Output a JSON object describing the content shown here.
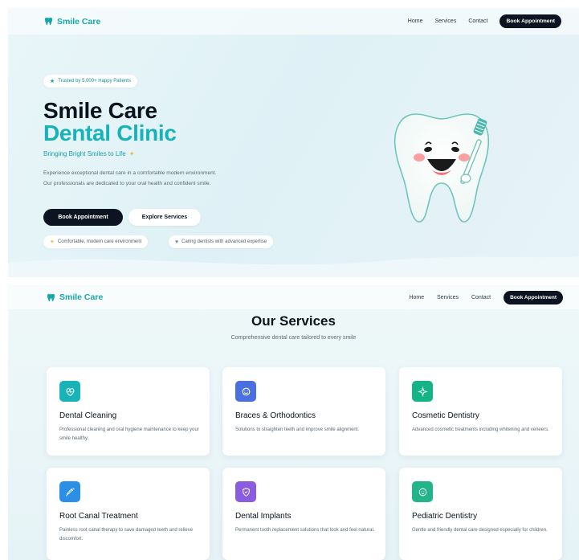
{
  "brand": {
    "name": "Smile Care",
    "icon": "tooth-icon",
    "color": "#16a8a8"
  },
  "nav": {
    "links": [
      "Home",
      "Services",
      "Contact"
    ],
    "cta": "Book Appointment"
  },
  "hero": {
    "badge": "Trusted by 5,000+ Happy Patients",
    "title_line1": "Smile Care",
    "title_line2": "Dental Clinic",
    "tagline": "Bringing Bright Smiles to Life",
    "description": "Experience exceptional dental care in a comfortable modern environment. Our professionals are dedicated to your oral health and confident smile.",
    "primary_button": "Book Appointment",
    "secondary_button": "Explore Services",
    "features": [
      "Comfortable, modern care environment",
      "Caring dentists with advanced expertise"
    ]
  },
  "services": {
    "title": "Our Services",
    "subtitle": "Comprehensive dental care tailored to every smile",
    "items": [
      {
        "title": "Dental Cleaning",
        "description": "Professional cleaning and oral hygiene maintenance to keep your smile healthy.",
        "icon": "heart-pulse-icon",
        "color": "#17b3b8"
      },
      {
        "title": "Braces & Orthodontics",
        "description": "Solutions to straighten teeth and improve smile alignment.",
        "icon": "smile-icon",
        "color": "#4a6fe0"
      },
      {
        "title": "Cosmetic Dentistry",
        "description": "Advanced cosmetic treatments including whitening and veneers.",
        "icon": "sparkles-icon",
        "color": "#15b487"
      },
      {
        "title": "Root Canal Treatment",
        "description": "Painless root canal therapy to save damaged teeth and relieve discomfort.",
        "icon": "syringe-icon",
        "color": "#2b8fe6"
      },
      {
        "title": "Dental Implants",
        "description": "Permanent tooth replacement solutions that look and feel natural.",
        "icon": "shield-icon",
        "color": "#8a5ce0"
      },
      {
        "title": "Pediatric Dentistry",
        "description": "Gentle and friendly dental care designed especially for children.",
        "icon": "baby-face-icon",
        "color": "#22b58a"
      }
    ]
  }
}
